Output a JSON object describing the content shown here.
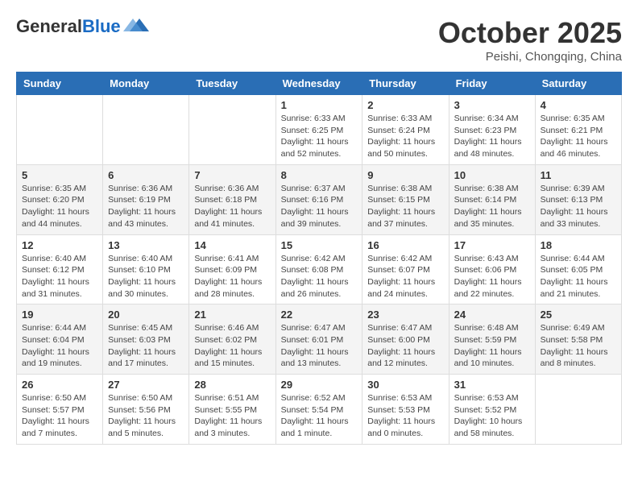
{
  "header": {
    "logo_general": "General",
    "logo_blue": "Blue",
    "month": "October 2025",
    "location": "Peishi, Chongqing, China"
  },
  "weekdays": [
    "Sunday",
    "Monday",
    "Tuesday",
    "Wednesday",
    "Thursday",
    "Friday",
    "Saturday"
  ],
  "weeks": [
    [
      {
        "day": "",
        "info": ""
      },
      {
        "day": "",
        "info": ""
      },
      {
        "day": "",
        "info": ""
      },
      {
        "day": "1",
        "info": "Sunrise: 6:33 AM\nSunset: 6:25 PM\nDaylight: 11 hours\nand 52 minutes."
      },
      {
        "day": "2",
        "info": "Sunrise: 6:33 AM\nSunset: 6:24 PM\nDaylight: 11 hours\nand 50 minutes."
      },
      {
        "day": "3",
        "info": "Sunrise: 6:34 AM\nSunset: 6:23 PM\nDaylight: 11 hours\nand 48 minutes."
      },
      {
        "day": "4",
        "info": "Sunrise: 6:35 AM\nSunset: 6:21 PM\nDaylight: 11 hours\nand 46 minutes."
      }
    ],
    [
      {
        "day": "5",
        "info": "Sunrise: 6:35 AM\nSunset: 6:20 PM\nDaylight: 11 hours\nand 44 minutes."
      },
      {
        "day": "6",
        "info": "Sunrise: 6:36 AM\nSunset: 6:19 PM\nDaylight: 11 hours\nand 43 minutes."
      },
      {
        "day": "7",
        "info": "Sunrise: 6:36 AM\nSunset: 6:18 PM\nDaylight: 11 hours\nand 41 minutes."
      },
      {
        "day": "8",
        "info": "Sunrise: 6:37 AM\nSunset: 6:16 PM\nDaylight: 11 hours\nand 39 minutes."
      },
      {
        "day": "9",
        "info": "Sunrise: 6:38 AM\nSunset: 6:15 PM\nDaylight: 11 hours\nand 37 minutes."
      },
      {
        "day": "10",
        "info": "Sunrise: 6:38 AM\nSunset: 6:14 PM\nDaylight: 11 hours\nand 35 minutes."
      },
      {
        "day": "11",
        "info": "Sunrise: 6:39 AM\nSunset: 6:13 PM\nDaylight: 11 hours\nand 33 minutes."
      }
    ],
    [
      {
        "day": "12",
        "info": "Sunrise: 6:40 AM\nSunset: 6:12 PM\nDaylight: 11 hours\nand 31 minutes."
      },
      {
        "day": "13",
        "info": "Sunrise: 6:40 AM\nSunset: 6:10 PM\nDaylight: 11 hours\nand 30 minutes."
      },
      {
        "day": "14",
        "info": "Sunrise: 6:41 AM\nSunset: 6:09 PM\nDaylight: 11 hours\nand 28 minutes."
      },
      {
        "day": "15",
        "info": "Sunrise: 6:42 AM\nSunset: 6:08 PM\nDaylight: 11 hours\nand 26 minutes."
      },
      {
        "day": "16",
        "info": "Sunrise: 6:42 AM\nSunset: 6:07 PM\nDaylight: 11 hours\nand 24 minutes."
      },
      {
        "day": "17",
        "info": "Sunrise: 6:43 AM\nSunset: 6:06 PM\nDaylight: 11 hours\nand 22 minutes."
      },
      {
        "day": "18",
        "info": "Sunrise: 6:44 AM\nSunset: 6:05 PM\nDaylight: 11 hours\nand 21 minutes."
      }
    ],
    [
      {
        "day": "19",
        "info": "Sunrise: 6:44 AM\nSunset: 6:04 PM\nDaylight: 11 hours\nand 19 minutes."
      },
      {
        "day": "20",
        "info": "Sunrise: 6:45 AM\nSunset: 6:03 PM\nDaylight: 11 hours\nand 17 minutes."
      },
      {
        "day": "21",
        "info": "Sunrise: 6:46 AM\nSunset: 6:02 PM\nDaylight: 11 hours\nand 15 minutes."
      },
      {
        "day": "22",
        "info": "Sunrise: 6:47 AM\nSunset: 6:01 PM\nDaylight: 11 hours\nand 13 minutes."
      },
      {
        "day": "23",
        "info": "Sunrise: 6:47 AM\nSunset: 6:00 PM\nDaylight: 11 hours\nand 12 minutes."
      },
      {
        "day": "24",
        "info": "Sunrise: 6:48 AM\nSunset: 5:59 PM\nDaylight: 11 hours\nand 10 minutes."
      },
      {
        "day": "25",
        "info": "Sunrise: 6:49 AM\nSunset: 5:58 PM\nDaylight: 11 hours\nand 8 minutes."
      }
    ],
    [
      {
        "day": "26",
        "info": "Sunrise: 6:50 AM\nSunset: 5:57 PM\nDaylight: 11 hours\nand 7 minutes."
      },
      {
        "day": "27",
        "info": "Sunrise: 6:50 AM\nSunset: 5:56 PM\nDaylight: 11 hours\nand 5 minutes."
      },
      {
        "day": "28",
        "info": "Sunrise: 6:51 AM\nSunset: 5:55 PM\nDaylight: 11 hours\nand 3 minutes."
      },
      {
        "day": "29",
        "info": "Sunrise: 6:52 AM\nSunset: 5:54 PM\nDaylight: 11 hours\nand 1 minute."
      },
      {
        "day": "30",
        "info": "Sunrise: 6:53 AM\nSunset: 5:53 PM\nDaylight: 11 hours\nand 0 minutes."
      },
      {
        "day": "31",
        "info": "Sunrise: 6:53 AM\nSunset: 5:52 PM\nDaylight: 10 hours\nand 58 minutes."
      },
      {
        "day": "",
        "info": ""
      }
    ]
  ]
}
